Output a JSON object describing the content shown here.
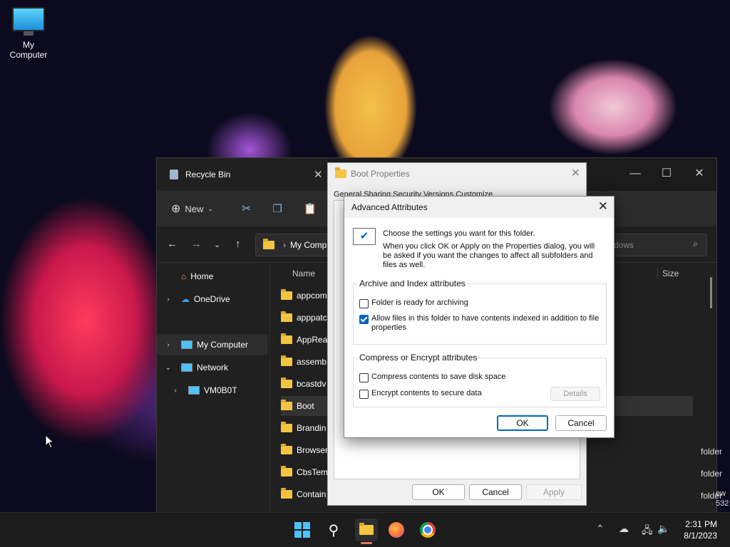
{
  "desktop": {
    "icon_label": "My Computer"
  },
  "explorer": {
    "tab_title": "Recycle Bin",
    "toolbar": {
      "new_label": "New"
    },
    "address": {
      "root": "My Compu"
    },
    "search": {
      "placeholder": "dows"
    },
    "sidebar": {
      "home": "Home",
      "onedrive": "OneDrive",
      "my_computer": "My Computer",
      "network": "Network",
      "vm": "VM0B0T"
    },
    "columns": {
      "name": "Name",
      "size": "Size"
    },
    "files": [
      "appcom",
      "apppatc",
      "AppRea",
      "assemb",
      "bcastdv",
      "Boot",
      "Brandin",
      "Browser",
      "CbsTem",
      "Contain"
    ],
    "type_col": [
      "folder",
      "folder",
      "folder"
    ],
    "edge_text": [
      "ew",
      "532"
    ]
  },
  "boot_props": {
    "title": "Boot Properties",
    "tabs": "General   Sharing   Security   Versions   Customize",
    "ok": "OK",
    "cancel": "Cancel",
    "apply": "Apply"
  },
  "advanced": {
    "title": "Advanced Attributes",
    "intro": "Choose the settings you want for this folder.",
    "intro_detail": "When you click OK or Apply on the Properties dialog, you will be asked if you want the changes to affect all subfolders and files as well.",
    "group1": "Archive and Index attributes",
    "archive": "Folder is ready for archiving",
    "index": "Allow files in this folder to have contents indexed in addition to file properties",
    "group2": "Compress or Encrypt attributes",
    "compress": "Compress contents to save disk space",
    "encrypt": "Encrypt contents to secure data",
    "details": "Details",
    "ok": "OK",
    "cancel": "Cancel",
    "checks": {
      "archive": false,
      "index": true,
      "compress": false,
      "encrypt": false
    }
  },
  "taskbar": {
    "time": "2:31 PM",
    "date": "8/1/2023"
  }
}
